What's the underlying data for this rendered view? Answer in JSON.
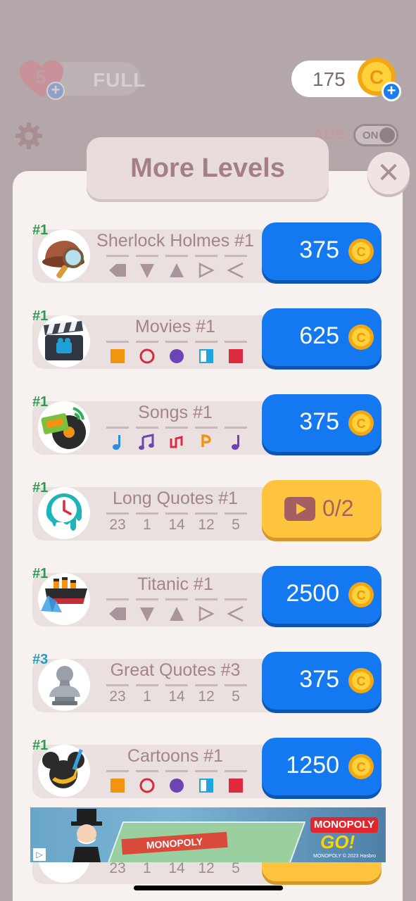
{
  "status": {
    "lives_count": "5",
    "lives_status": "FULL",
    "coin_balance": "175",
    "ads_label": "ADS",
    "ads_toggle": "ON"
  },
  "modal": {
    "title": "More Levels",
    "close_symbol": "✕"
  },
  "levels": [
    {
      "rank": "#1",
      "title": "Sherlock Holmes #1",
      "icon": "detective-hat-icon",
      "price": "375",
      "action": "coins",
      "glyph_set": "shapes"
    },
    {
      "rank": "#1",
      "title": "Movies #1",
      "icon": "clapperboard-icon",
      "price": "625",
      "action": "coins",
      "glyph_set": "colors"
    },
    {
      "rank": "#1",
      "title": "Songs #1",
      "icon": "cassette-vinyl-icon",
      "price": "375",
      "action": "coins",
      "glyph_set": "notes"
    },
    {
      "rank": "#1",
      "title": "Long Quotes #1",
      "icon": "melting-clock-icon",
      "price": "0/2",
      "action": "video",
      "glyph_set": "numbers",
      "numbers": [
        "23",
        "1",
        "14",
        "12",
        "5"
      ]
    },
    {
      "rank": "#1",
      "title": "Titanic #1",
      "icon": "ship-iceberg-icon",
      "price": "2500",
      "action": "coins",
      "glyph_set": "shapes"
    },
    {
      "rank": "#3",
      "title": "Great Quotes #3",
      "icon": "bust-statue-icon",
      "price": "375",
      "action": "coins",
      "glyph_set": "numbers",
      "numbers": [
        "23",
        "1",
        "14",
        "12",
        "5"
      ]
    },
    {
      "rank": "#1",
      "title": "Cartoons #1",
      "icon": "mouse-ears-icon",
      "price": "1250",
      "action": "coins",
      "glyph_set": "colors"
    }
  ],
  "partial_row_numbers": [
    "23",
    "1",
    "14",
    "12",
    "5"
  ],
  "ad": {
    "board_text": "MONOPOLY",
    "logo_line1": "MONOPOLY",
    "logo_line2": "GO!",
    "copyright": "MONOPOLY © 2023 Hasbro"
  },
  "colors": {
    "accent_blue": "#1479f0",
    "video_yellow": "#ffc43d",
    "rank_green": "#2f9a52",
    "rank_teal": "#2a9cba",
    "title_text": "#a3848b"
  }
}
